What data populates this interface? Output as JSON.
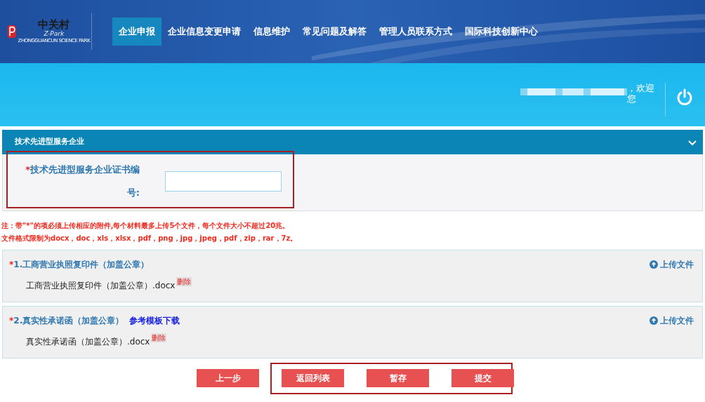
{
  "logo": {
    "name": "中关村",
    "sub": "Z-Park",
    "caption": "ZHONGGUANCUN SCIENCE PARK"
  },
  "nav": [
    {
      "label": "企业申报",
      "selected": true
    },
    {
      "label": "企业信息变更申请",
      "selected": false
    },
    {
      "label": "信息维护",
      "selected": false
    },
    {
      "label": "常见问题及解答",
      "selected": false
    },
    {
      "label": "管理人员联系方式",
      "selected": false
    },
    {
      "label": "国际科技创新中心",
      "selected": false
    }
  ],
  "user": {
    "greeting": "，欢迎您"
  },
  "panel": {
    "title": "技术先进型服务企业",
    "expanded": true
  },
  "field": {
    "required_mark": "*",
    "label": "技术先进型服务企业证书编号:"
  },
  "notes": [
    "注：带\"*\"的项必须上传相应的附件,每个材料最多上传5个文件，每个文件大小不超过20兆。",
    "文件格式限制为docx，doc，xls，xlsx，pdf，png，jpg，jpeg，pdf，zip，rar，7z。"
  ],
  "attachments": [
    {
      "required_mark": "*",
      "title": "1.工商营业执照复印件（加盖公章）",
      "upload": "上传文件",
      "file": "工商营业执照复印件（加盖公章）.docx",
      "delete": "删除"
    },
    {
      "required_mark": "*",
      "title": "2.真实性承诺函（加盖公章）",
      "template_link": "参考模板下载",
      "upload": "上传文件",
      "file": "真实性承诺函（加盖公章）.docx",
      "delete": "删除"
    }
  ],
  "buttons": [
    {
      "label": "上一步"
    },
    {
      "label": "返回列表"
    },
    {
      "label": "暂存"
    },
    {
      "label": "提交"
    }
  ]
}
